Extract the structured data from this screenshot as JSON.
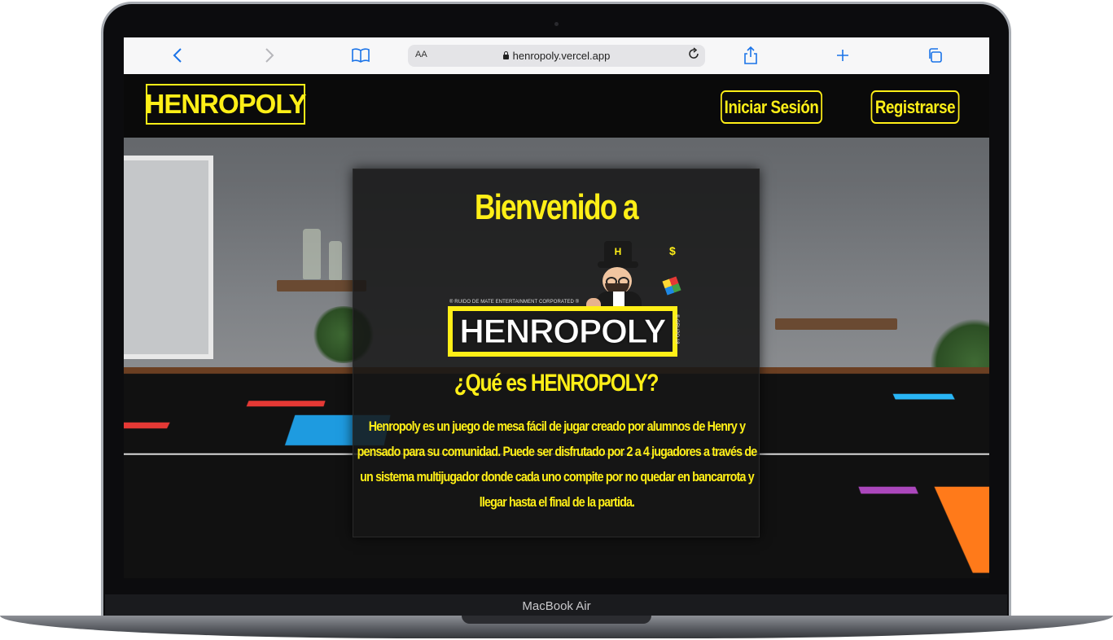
{
  "device": {
    "model_label": "MacBook Air"
  },
  "browser": {
    "text_size_label": "AA",
    "url": "henropoly.vercel.app",
    "icons": [
      "back-icon",
      "forward-icon",
      "bookmarks-icon",
      "reload-icon",
      "share-icon",
      "new-tab-icon",
      "tabs-icon"
    ]
  },
  "header": {
    "logo_text": "HENROPOLY",
    "login_label": "Iniciar Sesión",
    "register_label": "Registrarse"
  },
  "hero": {
    "welcome": "Bienvenido a",
    "logo_corp": "® RUIDO DE MATE ENTERTAINMENT CORPORATED ®",
    "logo_group": "® GRUPO 18",
    "logo_text": "HENROPOLY",
    "mascot_hat": "H",
    "subtitle": "¿Qué es HENROPOLY?",
    "description": "Henropoly es un juego de mesa fácil de jugar creado por alumnos de Henry y pensado para su comunidad. Puede ser disfrutado por 2 a 4 jugadores a través de un sistema multijugador donde cada uno compite por no quedar en bancarrota y llegar hasta el final de la partida."
  },
  "colors": {
    "accent": "#ffef17",
    "nav_bg": "#0a0a0a",
    "browser_blue": "#1a73e8"
  }
}
